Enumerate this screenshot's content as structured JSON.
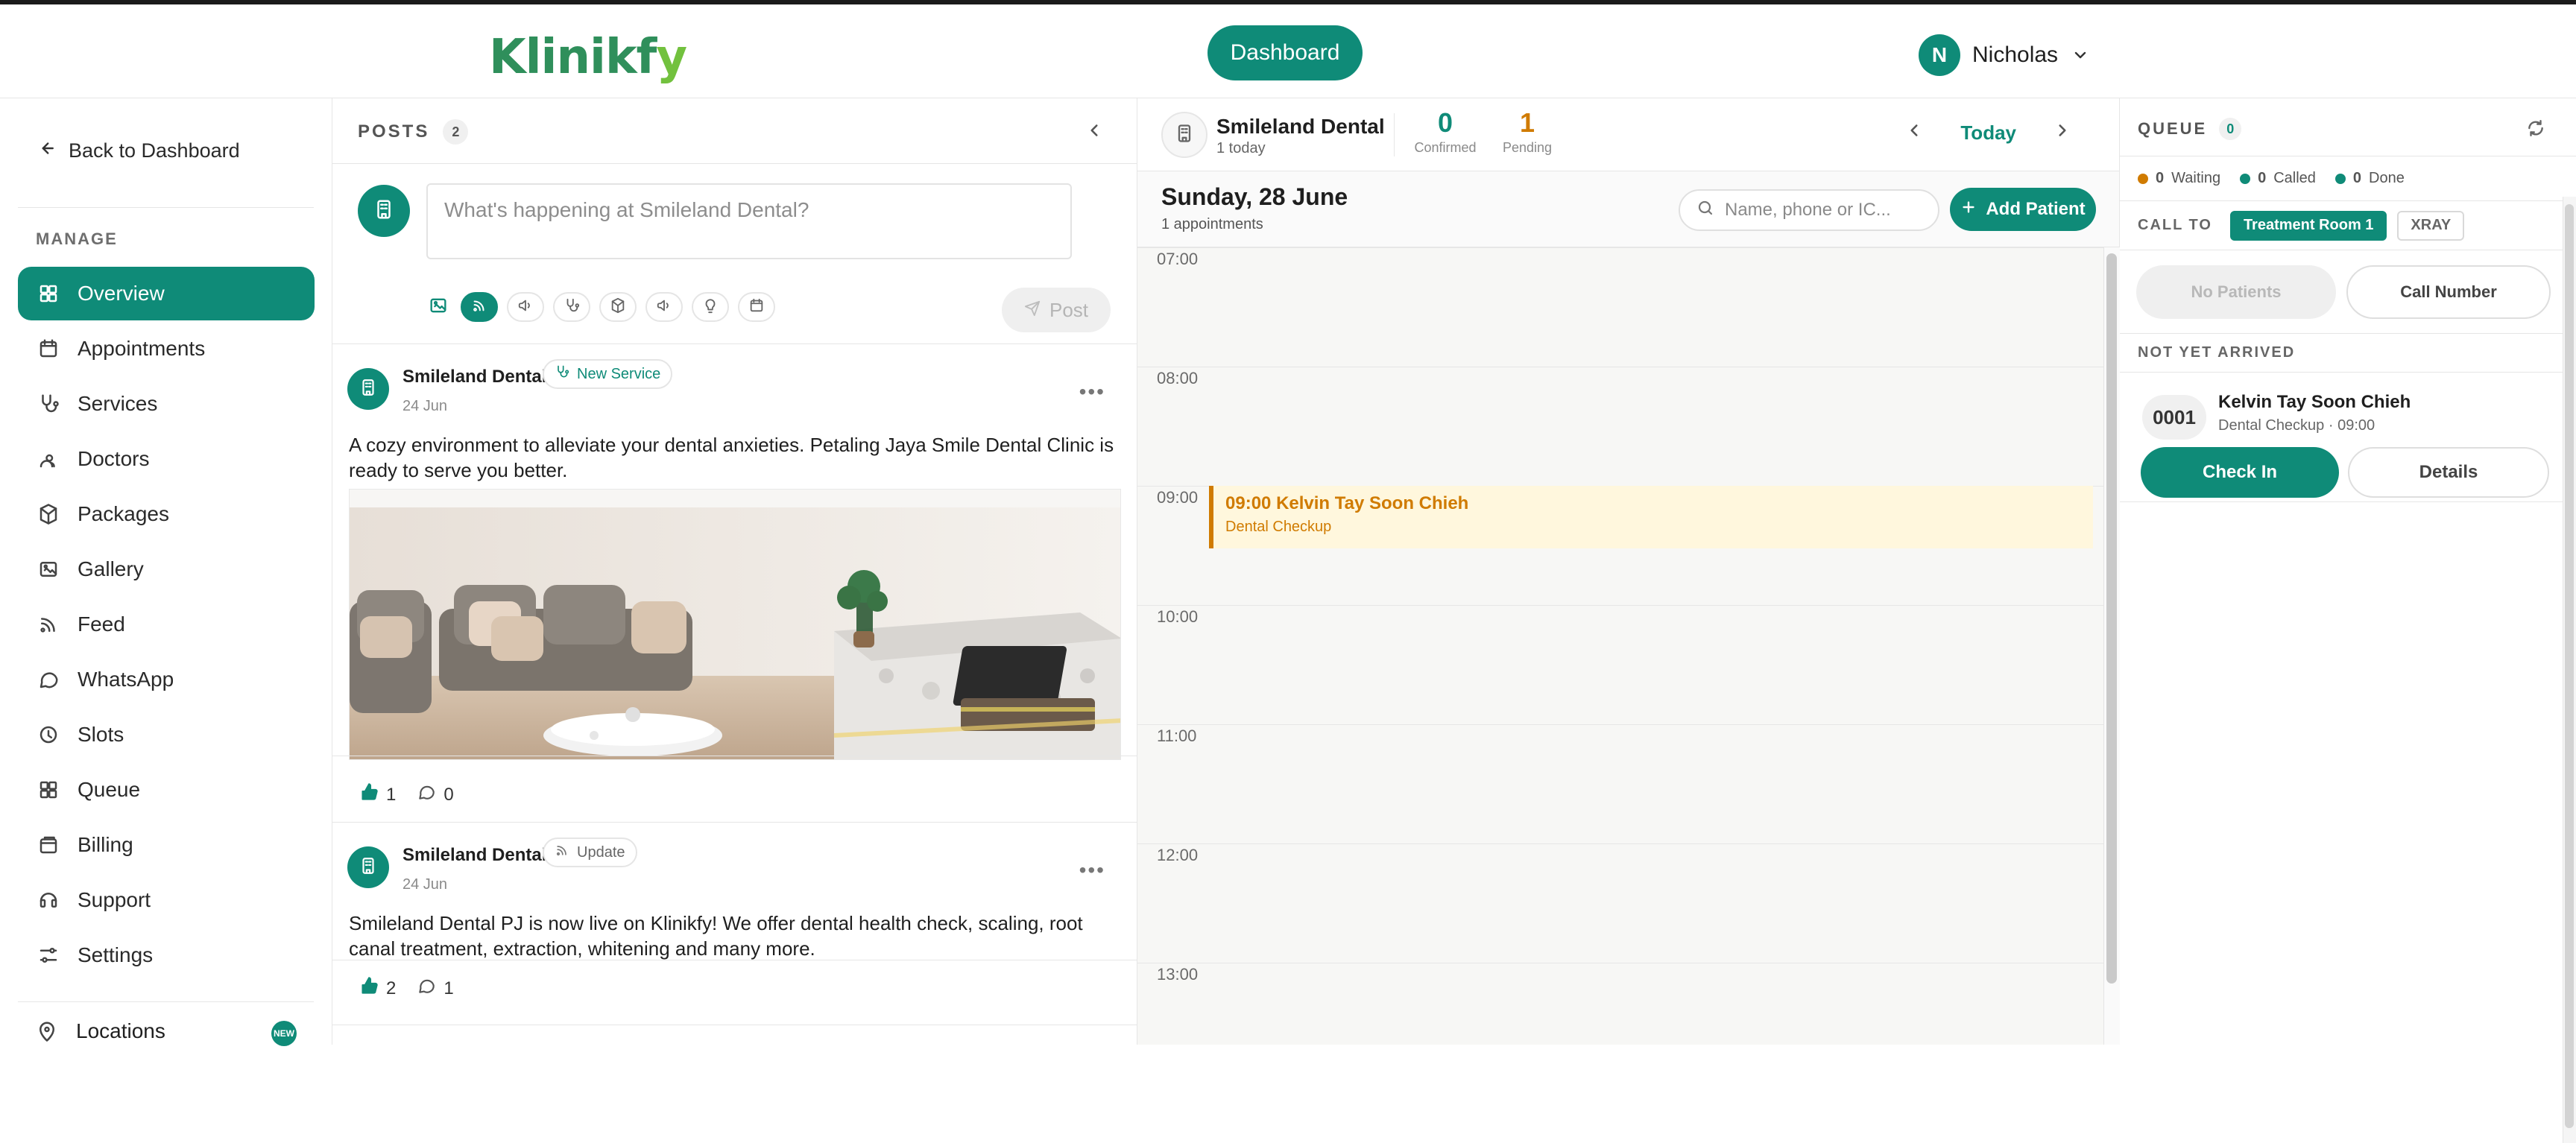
{
  "app": {
    "logo_main": "Klinikf",
    "logo_y": "y",
    "top_button": "Dashboard",
    "user_initial": "N",
    "user_name": "Nicholas",
    "brand_color": "#0f8b78"
  },
  "sidebar": {
    "back_label": "Back to Dashboard",
    "section_label": "MANAGE",
    "items": [
      {
        "label": "Overview",
        "icon": "grid-icon",
        "active": true
      },
      {
        "label": "Appointments",
        "icon": "calendar-icon",
        "active": false
      },
      {
        "label": "Services",
        "icon": "stethoscope-icon",
        "active": false
      },
      {
        "label": "Doctors",
        "icon": "users-icon",
        "active": false
      },
      {
        "label": "Packages",
        "icon": "package-icon",
        "active": false
      },
      {
        "label": "Gallery",
        "icon": "image-icon",
        "active": false
      },
      {
        "label": "Feed",
        "icon": "rss-icon",
        "active": false
      },
      {
        "label": "WhatsApp",
        "icon": "message-icon",
        "active": false
      },
      {
        "label": "Slots",
        "icon": "clock-icon",
        "active": false
      },
      {
        "label": "Queue",
        "icon": "grid-icon",
        "active": false
      },
      {
        "label": "Billing",
        "icon": "wallet-icon",
        "active": false
      },
      {
        "label": "Support",
        "icon": "headset-icon",
        "active": false
      },
      {
        "label": "Settings",
        "icon": "sliders-icon",
        "active": false
      }
    ],
    "locations_label": "Locations",
    "locations_badge": "NEW"
  },
  "posts": {
    "title": "POSTS",
    "count": "2",
    "composer_placeholder": "What's happening at Smileland Dental?",
    "post_button": "Post",
    "items": [
      {
        "author": "Smileland Dental",
        "tag": "New Service",
        "date": "24 Jun",
        "text": "A cozy environment to alleviate your dental anxieties. Petaling Jaya Smile Dental Clinic is ready to serve you better.",
        "likes": "1",
        "comments": "0"
      },
      {
        "author": "Smileland Dental",
        "tag": "Update",
        "date": "24 Jun",
        "text": "Smileland Dental PJ is now live on Klinikfy! We offer dental health check, scaling, root canal treatment, extraction, whitening and many more.",
        "likes": "2",
        "comments": "1"
      }
    ]
  },
  "calendar": {
    "clinic_name": "Smileland Dental",
    "clinic_sub": "1 today",
    "confirmed_num": "0",
    "confirmed_lbl": "Confirmed",
    "pending_num": "1",
    "pending_lbl": "Pending",
    "today": "Today",
    "date_title": "Sunday, 28 June",
    "date_sub": "1 appointments",
    "search_placeholder": "Name, phone or IC...",
    "add_patient": "Add Patient",
    "times": [
      "07:00",
      "08:00",
      "09:00",
      "10:00",
      "11:00",
      "12:00",
      "13:00"
    ],
    "appointment": {
      "time": "09:00",
      "name": "Kelvin Tay Soon Chieh",
      "service": "Dental Checkup"
    }
  },
  "queue": {
    "title": "QUEUE",
    "count": "0",
    "waiting_num": "0",
    "waiting_lbl": "Waiting",
    "called_num": "0",
    "called_lbl": "Called",
    "done_num": "0",
    "done_lbl": "Done",
    "call_to_label": "CALL TO",
    "rooms": [
      "Treatment Room 1",
      "XRAY"
    ],
    "no_patients": "No Patients",
    "call_number": "Call Number",
    "section_label": "NOT YET ARRIVED",
    "patient": {
      "number": "0001",
      "name": "Kelvin Tay Soon Chieh",
      "sub": "Dental Checkup · 09:00"
    },
    "check_in": "Check In",
    "details": "Details"
  }
}
